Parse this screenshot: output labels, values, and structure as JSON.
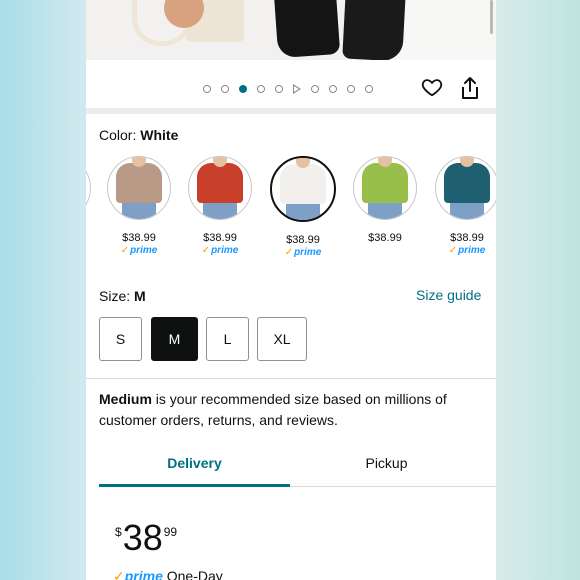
{
  "gallery": {
    "dot_count": 10,
    "active_dot": 2,
    "video_dot": 5
  },
  "color": {
    "label": "Color:",
    "selected": "White",
    "swatches": [
      {
        "name": "khaki",
        "shirt_color": "#b89a86",
        "price": "$38.99",
        "prime": "prime",
        "selected": false
      },
      {
        "name": "red",
        "shirt_color": "#c9402a",
        "price": "$38.99",
        "prime": "prime",
        "selected": false
      },
      {
        "name": "white",
        "shirt_color": "#f2f0ec",
        "price": "$38.99",
        "prime": "prime",
        "selected": true
      },
      {
        "name": "green",
        "shirt_color": "#98bf4a",
        "price": "$38.99",
        "prime": "",
        "selected": false
      },
      {
        "name": "teal",
        "shirt_color": "#1e5f72",
        "price": "$38.99",
        "prime": "prime",
        "selected": false
      }
    ]
  },
  "size": {
    "label": "Size:",
    "selected": "M",
    "guide_link": "Size guide",
    "options": [
      "S",
      "M",
      "L",
      "XL"
    ]
  },
  "recommendation": {
    "bold": "Medium",
    "text": " is your recommended size based on millions of customer orders, returns, and reviews."
  },
  "tabs": {
    "delivery": "Delivery",
    "pickup": "Pickup"
  },
  "price": {
    "currency": "$",
    "whole": "38",
    "fraction": "99"
  },
  "shipping": {
    "prime": "prime",
    "text": " One-Day"
  },
  "colors": {
    "accent": "#007185",
    "prime_blue": "#1a98ff",
    "prime_orange": "#ff9900"
  }
}
